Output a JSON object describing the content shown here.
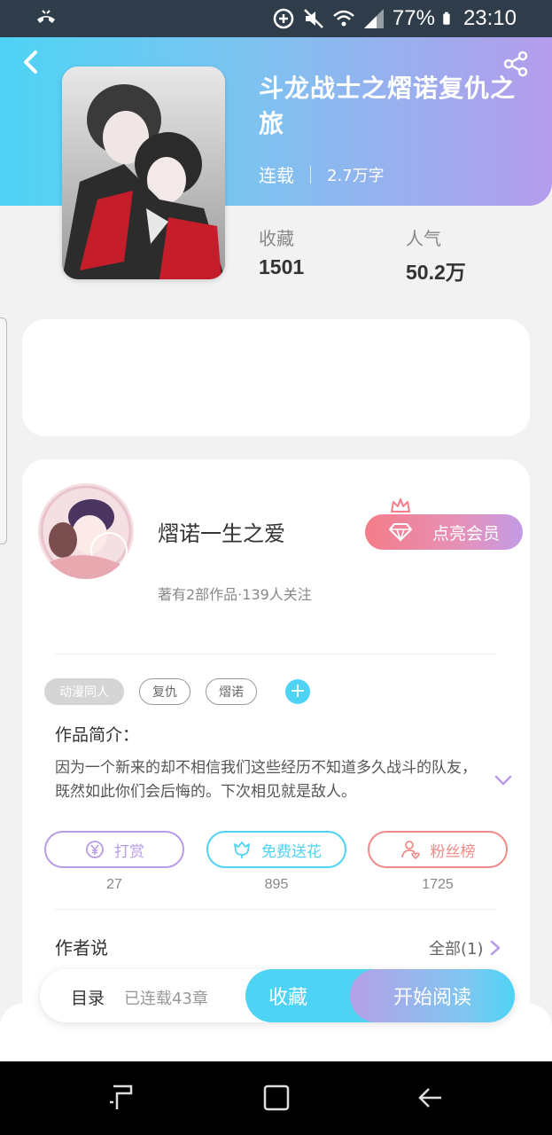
{
  "status_bar": {
    "battery": "77%",
    "time": "23:10",
    "icons": [
      "phone-call-icon",
      "data-saver-icon",
      "mute-icon",
      "wifi-icon",
      "signal-icon",
      "battery-icon"
    ]
  },
  "header": {
    "back_icon": "chevron-left-icon",
    "share_icon": "share-icon",
    "title": "斗龙战士之熠诺复仇之旅",
    "status": "连载",
    "word_count": "2.7万字"
  },
  "stats": [
    {
      "label": "收藏",
      "value": "1501"
    },
    {
      "label": "人气",
      "value": "50.2万"
    }
  ],
  "author": {
    "name": "熠诺一生之爱",
    "stats": "著有2部作品·139人关注",
    "vip_label": "点亮会员"
  },
  "tags": [
    "动漫同人",
    "复仇",
    "熠诺"
  ],
  "intro": {
    "label": "作品简介：",
    "text": "因为一个新来的却不相信我们这些经历不知道多久战斗的队友，既然如此你们会后悔的。下次相见就是敌人。"
  },
  "actions": [
    {
      "label": "打赏",
      "count": "27",
      "icon": "yen-coin-icon",
      "color": "#b99be8"
    },
    {
      "label": "免费送花",
      "count": "895",
      "icon": "flower-icon",
      "color": "#4ed3f5"
    },
    {
      "label": "粉丝榜",
      "count": "1725",
      "icon": "fan-user-icon",
      "color": "#f08a8a"
    }
  ],
  "author_says": {
    "label": "作者说",
    "all_label": "全部(1)"
  },
  "bottom_bar": {
    "toc_label": "目录",
    "toc_status": "已连载43章",
    "fav_label": "收藏",
    "read_label": "开始阅读"
  },
  "colors": {
    "accent_cyan": "#4ed3f5",
    "accent_purple": "#b59cec",
    "vip_pink": "#f47c88"
  }
}
